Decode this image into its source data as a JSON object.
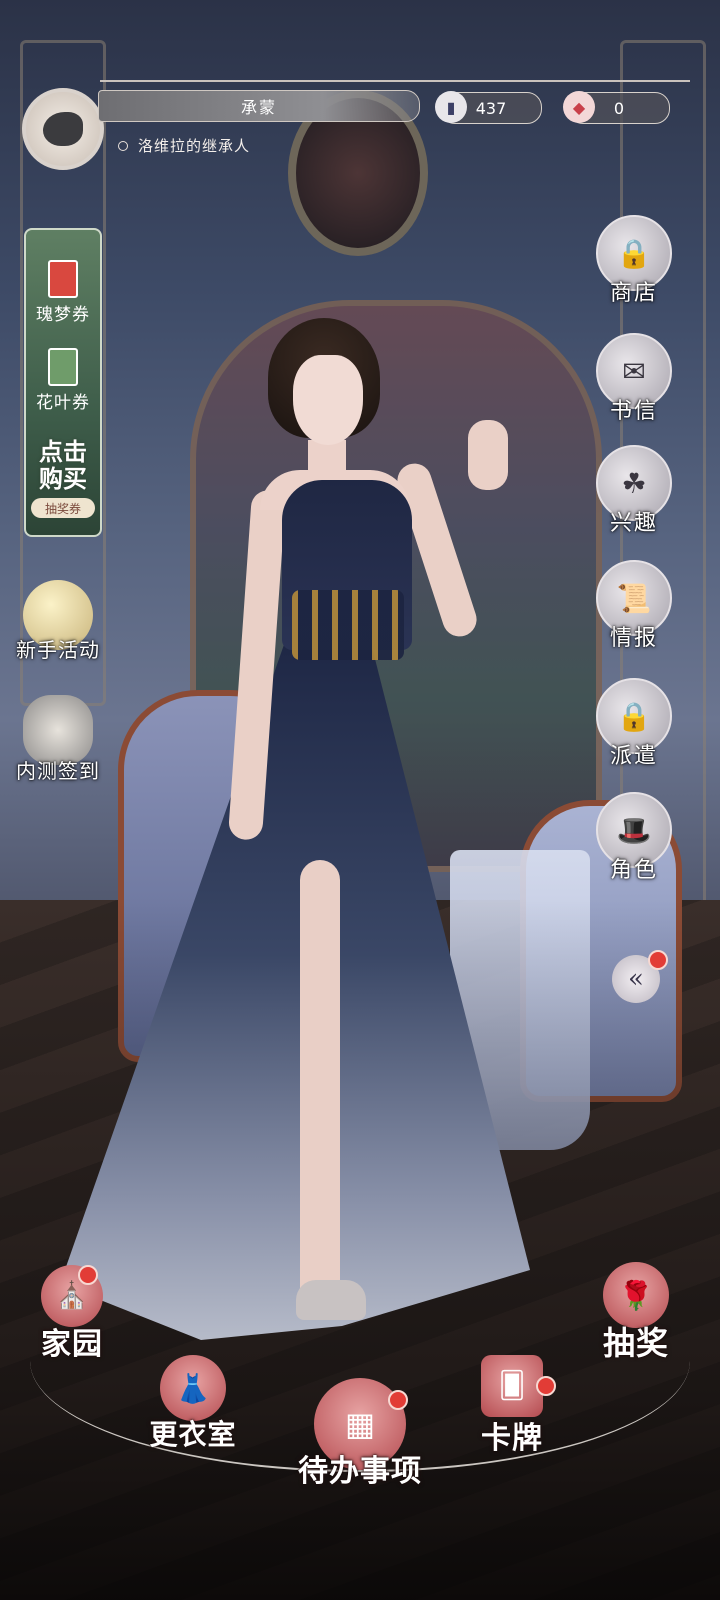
{
  "header": {
    "player_name": "承蒙",
    "player_title": "洛维拉的继承人",
    "currencies": [
      {
        "icon": "book-currency-icon",
        "value": "437"
      },
      {
        "icon": "gem-currency-icon",
        "value": "0"
      }
    ]
  },
  "left_banner": {
    "tickets": [
      {
        "label": "瑰梦券",
        "icon": "rose-ticket-icon",
        "color": "#d9483f"
      },
      {
        "label": "花叶券",
        "icon": "leaf-ticket-icon",
        "color": "#6f9c6a"
      }
    ],
    "buy_line1": "点击",
    "buy_line2": "购买",
    "tag": "抽奖券"
  },
  "left_buttons": [
    {
      "label": "新手活动",
      "icon": "moon-orb-icon"
    },
    {
      "label": "内测签到",
      "icon": "crow-letter-icon"
    }
  ],
  "right_menu": [
    {
      "label": "商店",
      "icon": "lock-icon",
      "locked": true
    },
    {
      "label": "书信",
      "icon": "letter-crow-icon"
    },
    {
      "label": "兴趣",
      "icon": "clover-icon"
    },
    {
      "label": "情报",
      "icon": "scroll-icon"
    },
    {
      "label": "派遣",
      "icon": "lock-icon",
      "locked": true
    },
    {
      "label": "角色",
      "icon": "top-hat-icon"
    }
  ],
  "bottom_nav": [
    {
      "label": "家园",
      "icon": "window-icon"
    },
    {
      "label": "更衣室",
      "icon": "dress-icon"
    },
    {
      "label": "待办事项",
      "icon": "tray-icon"
    },
    {
      "label": "卡牌",
      "icon": "card-icon"
    },
    {
      "label": "抽奖",
      "icon": "rose-icon"
    }
  ],
  "colors": {
    "notification": "#e23c36",
    "nav_accent": "#b44a4f",
    "banner_green": "#3e5d4a"
  }
}
